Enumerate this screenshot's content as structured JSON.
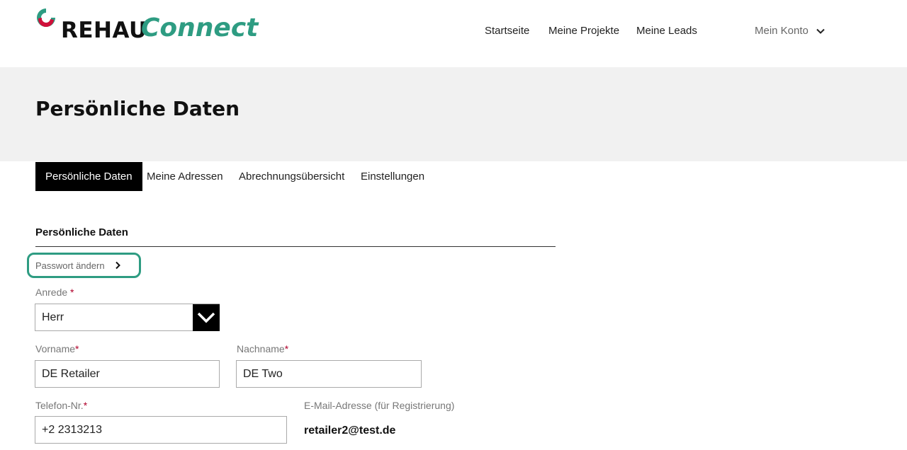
{
  "header": {
    "brand_name": "REHAU",
    "brand_product": "Connect",
    "nav": {
      "home": "Startseite",
      "projects": "Meine Projekte",
      "leads": "Meine Leads",
      "account": "Mein Konto"
    }
  },
  "page": {
    "title": "Persönliche Daten"
  },
  "tabs": [
    {
      "label": "Persönliche Daten",
      "active": true
    },
    {
      "label": "Meine Adressen",
      "active": false
    },
    {
      "label": "Abrechnungsübersicht",
      "active": false
    },
    {
      "label": "Einstellungen",
      "active": false
    }
  ],
  "section": {
    "title": "Persönliche Daten",
    "change_password": "Passwort ändern"
  },
  "form": {
    "salutation": {
      "label": "Anrede",
      "required": "*",
      "value": "Herr"
    },
    "first_name": {
      "label": "Vorname",
      "required": "*",
      "value": "DE Retailer"
    },
    "last_name": {
      "label": "Nachname",
      "required": "*",
      "value": "DE Two"
    },
    "phone": {
      "label": "Telefon-Nr.",
      "required": "*",
      "value": "+2 2313213"
    },
    "email": {
      "label": "E-Mail-Adresse (für Registrierung)",
      "value": "retailer2@test.de"
    }
  },
  "colors": {
    "accent": "#2e9c82",
    "required": "#b0002a",
    "tab_active_bg": "#000000",
    "hero_bg": "#f1f1f1"
  },
  "icons": {
    "account_dropdown": "chevron-down-icon",
    "password_link": "chevron-right-icon",
    "select_toggle": "chevron-down-icon"
  }
}
